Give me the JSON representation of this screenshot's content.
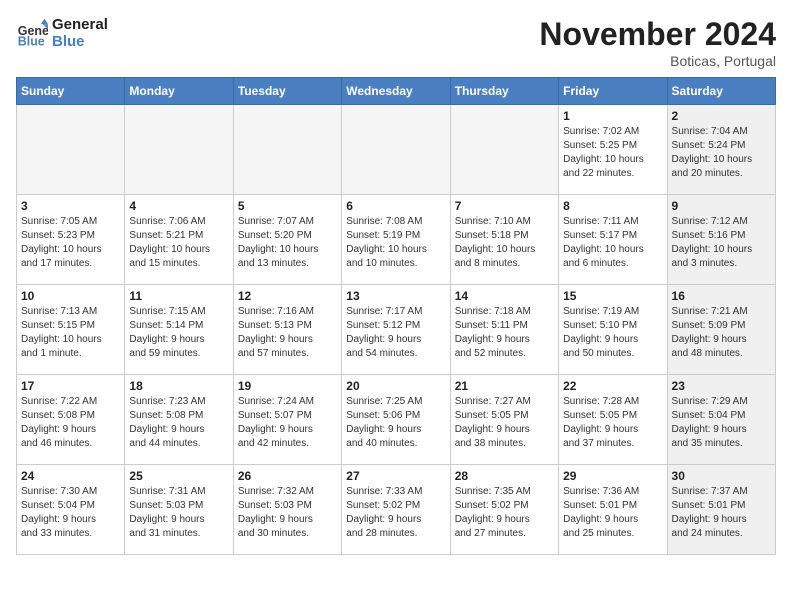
{
  "header": {
    "logo_line1": "General",
    "logo_line2": "Blue",
    "month_title": "November 2024",
    "location": "Boticas, Portugal"
  },
  "weekdays": [
    "Sunday",
    "Monday",
    "Tuesday",
    "Wednesday",
    "Thursday",
    "Friday",
    "Saturday"
  ],
  "weeks": [
    [
      {
        "day": "",
        "info": "",
        "shaded": true
      },
      {
        "day": "",
        "info": "",
        "shaded": true
      },
      {
        "day": "",
        "info": "",
        "shaded": true
      },
      {
        "day": "",
        "info": "",
        "shaded": true
      },
      {
        "day": "",
        "info": "",
        "shaded": true
      },
      {
        "day": "1",
        "info": "Sunrise: 7:02 AM\nSunset: 5:25 PM\nDaylight: 10 hours\nand 22 minutes.",
        "shaded": false
      },
      {
        "day": "2",
        "info": "Sunrise: 7:04 AM\nSunset: 5:24 PM\nDaylight: 10 hours\nand 20 minutes.",
        "shaded": true
      }
    ],
    [
      {
        "day": "3",
        "info": "Sunrise: 7:05 AM\nSunset: 5:23 PM\nDaylight: 10 hours\nand 17 minutes.",
        "shaded": false
      },
      {
        "day": "4",
        "info": "Sunrise: 7:06 AM\nSunset: 5:21 PM\nDaylight: 10 hours\nand 15 minutes.",
        "shaded": false
      },
      {
        "day": "5",
        "info": "Sunrise: 7:07 AM\nSunset: 5:20 PM\nDaylight: 10 hours\nand 13 minutes.",
        "shaded": false
      },
      {
        "day": "6",
        "info": "Sunrise: 7:08 AM\nSunset: 5:19 PM\nDaylight: 10 hours\nand 10 minutes.",
        "shaded": false
      },
      {
        "day": "7",
        "info": "Sunrise: 7:10 AM\nSunset: 5:18 PM\nDaylight: 10 hours\nand 8 minutes.",
        "shaded": false
      },
      {
        "day": "8",
        "info": "Sunrise: 7:11 AM\nSunset: 5:17 PM\nDaylight: 10 hours\nand 6 minutes.",
        "shaded": false
      },
      {
        "day": "9",
        "info": "Sunrise: 7:12 AM\nSunset: 5:16 PM\nDaylight: 10 hours\nand 3 minutes.",
        "shaded": true
      }
    ],
    [
      {
        "day": "10",
        "info": "Sunrise: 7:13 AM\nSunset: 5:15 PM\nDaylight: 10 hours\nand 1 minute.",
        "shaded": false
      },
      {
        "day": "11",
        "info": "Sunrise: 7:15 AM\nSunset: 5:14 PM\nDaylight: 9 hours\nand 59 minutes.",
        "shaded": false
      },
      {
        "day": "12",
        "info": "Sunrise: 7:16 AM\nSunset: 5:13 PM\nDaylight: 9 hours\nand 57 minutes.",
        "shaded": false
      },
      {
        "day": "13",
        "info": "Sunrise: 7:17 AM\nSunset: 5:12 PM\nDaylight: 9 hours\nand 54 minutes.",
        "shaded": false
      },
      {
        "day": "14",
        "info": "Sunrise: 7:18 AM\nSunset: 5:11 PM\nDaylight: 9 hours\nand 52 minutes.",
        "shaded": false
      },
      {
        "day": "15",
        "info": "Sunrise: 7:19 AM\nSunset: 5:10 PM\nDaylight: 9 hours\nand 50 minutes.",
        "shaded": false
      },
      {
        "day": "16",
        "info": "Sunrise: 7:21 AM\nSunset: 5:09 PM\nDaylight: 9 hours\nand 48 minutes.",
        "shaded": true
      }
    ],
    [
      {
        "day": "17",
        "info": "Sunrise: 7:22 AM\nSunset: 5:08 PM\nDaylight: 9 hours\nand 46 minutes.",
        "shaded": false
      },
      {
        "day": "18",
        "info": "Sunrise: 7:23 AM\nSunset: 5:08 PM\nDaylight: 9 hours\nand 44 minutes.",
        "shaded": false
      },
      {
        "day": "19",
        "info": "Sunrise: 7:24 AM\nSunset: 5:07 PM\nDaylight: 9 hours\nand 42 minutes.",
        "shaded": false
      },
      {
        "day": "20",
        "info": "Sunrise: 7:25 AM\nSunset: 5:06 PM\nDaylight: 9 hours\nand 40 minutes.",
        "shaded": false
      },
      {
        "day": "21",
        "info": "Sunrise: 7:27 AM\nSunset: 5:05 PM\nDaylight: 9 hours\nand 38 minutes.",
        "shaded": false
      },
      {
        "day": "22",
        "info": "Sunrise: 7:28 AM\nSunset: 5:05 PM\nDaylight: 9 hours\nand 37 minutes.",
        "shaded": false
      },
      {
        "day": "23",
        "info": "Sunrise: 7:29 AM\nSunset: 5:04 PM\nDaylight: 9 hours\nand 35 minutes.",
        "shaded": true
      }
    ],
    [
      {
        "day": "24",
        "info": "Sunrise: 7:30 AM\nSunset: 5:04 PM\nDaylight: 9 hours\nand 33 minutes.",
        "shaded": false
      },
      {
        "day": "25",
        "info": "Sunrise: 7:31 AM\nSunset: 5:03 PM\nDaylight: 9 hours\nand 31 minutes.",
        "shaded": false
      },
      {
        "day": "26",
        "info": "Sunrise: 7:32 AM\nSunset: 5:03 PM\nDaylight: 9 hours\nand 30 minutes.",
        "shaded": false
      },
      {
        "day": "27",
        "info": "Sunrise: 7:33 AM\nSunset: 5:02 PM\nDaylight: 9 hours\nand 28 minutes.",
        "shaded": false
      },
      {
        "day": "28",
        "info": "Sunrise: 7:35 AM\nSunset: 5:02 PM\nDaylight: 9 hours\nand 27 minutes.",
        "shaded": false
      },
      {
        "day": "29",
        "info": "Sunrise: 7:36 AM\nSunset: 5:01 PM\nDaylight: 9 hours\nand 25 minutes.",
        "shaded": false
      },
      {
        "day": "30",
        "info": "Sunrise: 7:37 AM\nSunset: 5:01 PM\nDaylight: 9 hours\nand 24 minutes.",
        "shaded": true
      }
    ]
  ]
}
